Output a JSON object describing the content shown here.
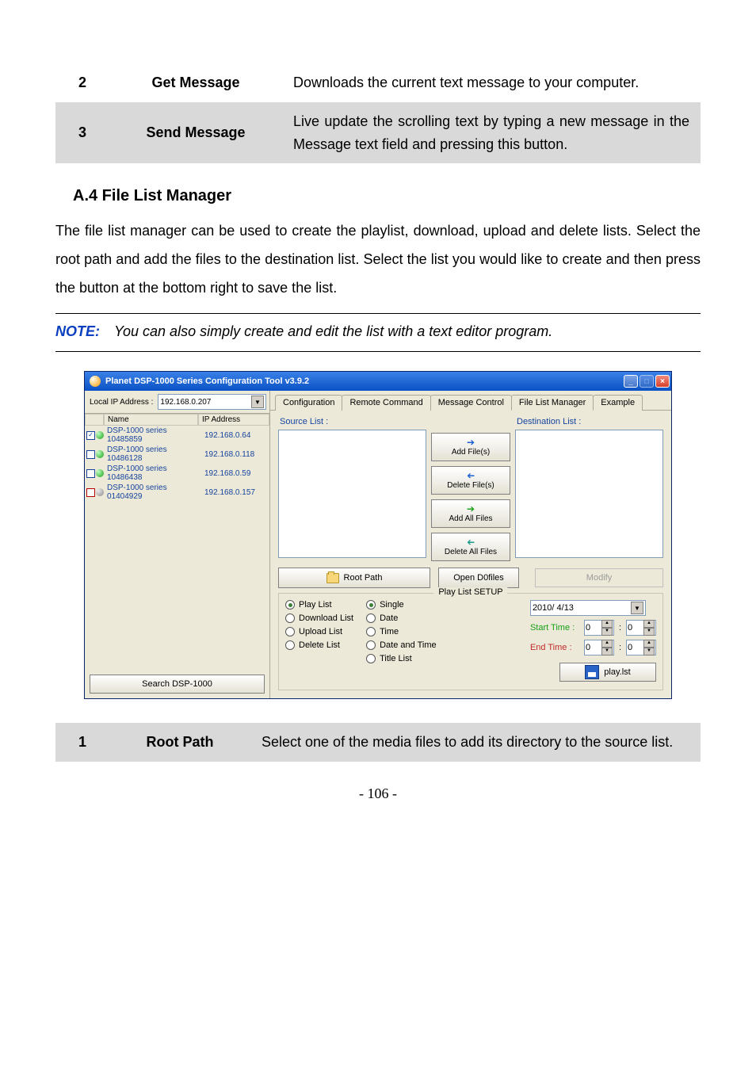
{
  "topTable": {
    "row2": {
      "num": "2",
      "name": "Get Message",
      "desc": "Downloads the current text message to your computer."
    },
    "row3": {
      "num": "3",
      "name": "Send Message",
      "desc": "Live update the scrolling text by typing a new message in the Message text field and pressing this button."
    }
  },
  "section": {
    "heading": "A.4   File List Manager",
    "body": "The file list manager can be used to create the playlist, download, upload and delete lists. Select the root path and add the files to the destination list. Select the list you would like to create and then press the button at the bottom right to save the list."
  },
  "note": {
    "label": "NOTE:",
    "text": "You can also simply create and edit the list with a text editor program."
  },
  "app": {
    "title": "Planet DSP-1000 Series Configuration Tool v3.9.2",
    "winMin": "_",
    "winMax": "□",
    "winClose": "×",
    "localIpLabel": "Local IP Address :",
    "localIpValue": "192.168.0.207",
    "col": {
      "name": "Name",
      "ip": "IP Address"
    },
    "devices": [
      {
        "checked": true,
        "status": "green",
        "name": "DSP-1000 series 10485859",
        "ip": "192.168.0.64"
      },
      {
        "checked": false,
        "status": "green",
        "name": "DSP-1000 series 10486128",
        "ip": "192.168.0.118"
      },
      {
        "checked": false,
        "status": "green",
        "name": "DSP-1000 series 10486438",
        "ip": "192.168.0.59"
      },
      {
        "checked": false,
        "status": "gray",
        "name": "DSP-1000 series 01404929",
        "ip": "192.168.0.157"
      }
    ],
    "searchBtn": "Search DSP-1000",
    "tabs": {
      "cfg": "Configuration",
      "rc": "Remote Command",
      "mc": "Message Control",
      "flm": "File List Manager",
      "ex": "Example"
    },
    "sourceLabel": "Source List :",
    "destLabel": "Destination List :",
    "midBtns": {
      "add": "Add File(s)",
      "del": "Delete File(s)",
      "addAll": "Add All Files",
      "delAll": "Delete All Files"
    },
    "rootPathBtn": "Root Path",
    "openDBtn": "Open D0files",
    "modifyBtn": "Modify",
    "setup": {
      "legend": "Play List SETUP",
      "leftRadios": {
        "play": "Play List",
        "download": "Download List",
        "upload": "Upload List",
        "delete": "Delete List"
      },
      "rightRadios": {
        "single": "Single",
        "date": "Date",
        "time": "Time",
        "datetime": "Date and Time",
        "titlelist": "Title List"
      },
      "dateValue": "2010/ 4/13",
      "startLabel": "Start Time :",
      "endLabel": "End Time :",
      "spin": "0",
      "colon": ":",
      "saveFile": "play.lst"
    }
  },
  "bottomTable": {
    "row1": {
      "num": "1",
      "name": "Root Path",
      "desc": "Select one of the media files to add its directory to the source list."
    }
  },
  "pageNum": "- 106 -"
}
